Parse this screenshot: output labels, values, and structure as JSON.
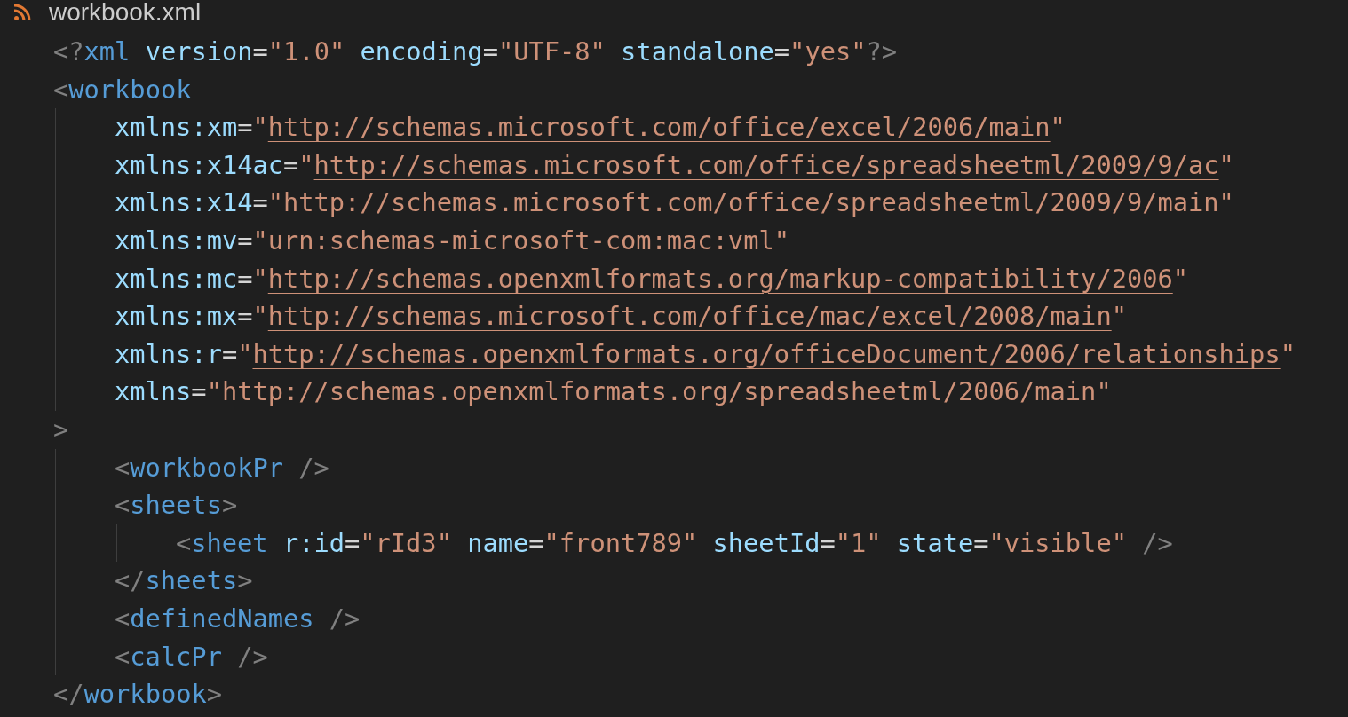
{
  "file_tab": {
    "title": "workbook.xml"
  },
  "lines": [
    {
      "tokens": [
        {
          "kind": "bracket",
          "text": "<?"
        },
        {
          "kind": "tag",
          "text": "xml"
        },
        {
          "kind": "attr",
          "text": " version"
        },
        {
          "kind": "eq",
          "text": "="
        },
        {
          "kind": "string",
          "text": "\"1.0\""
        },
        {
          "kind": "attr",
          "text": " encoding"
        },
        {
          "kind": "eq",
          "text": "="
        },
        {
          "kind": "string",
          "text": "\"UTF-8\""
        },
        {
          "kind": "attr",
          "text": " standalone"
        },
        {
          "kind": "eq",
          "text": "="
        },
        {
          "kind": "string",
          "text": "\"yes\""
        },
        {
          "kind": "bracket",
          "text": "?>"
        }
      ]
    },
    {
      "tokens": [
        {
          "kind": "bracket",
          "text": "<"
        },
        {
          "kind": "tag",
          "text": "workbook"
        }
      ],
      "children": [
        {
          "tokens": [
            {
              "kind": "attr",
              "text": "xmlns:xm"
            },
            {
              "kind": "eq",
              "text": "="
            },
            {
              "kind": "string",
              "text": "\""
            },
            {
              "kind": "link",
              "text": "http://schemas.microsoft.com/office/excel/2006/main"
            },
            {
              "kind": "string",
              "text": "\""
            }
          ]
        },
        {
          "tokens": [
            {
              "kind": "attr",
              "text": "xmlns:x14ac"
            },
            {
              "kind": "eq",
              "text": "="
            },
            {
              "kind": "string",
              "text": "\""
            },
            {
              "kind": "link",
              "text": "http://schemas.microsoft.com/office/spreadsheetml/2009/9/ac"
            },
            {
              "kind": "string",
              "text": "\""
            }
          ]
        },
        {
          "tokens": [
            {
              "kind": "attr",
              "text": "xmlns:x14"
            },
            {
              "kind": "eq",
              "text": "="
            },
            {
              "kind": "string",
              "text": "\""
            },
            {
              "kind": "link",
              "text": "http://schemas.microsoft.com/office/spreadsheetml/2009/9/main"
            },
            {
              "kind": "string",
              "text": "\""
            }
          ]
        },
        {
          "tokens": [
            {
              "kind": "attr",
              "text": "xmlns:mv"
            },
            {
              "kind": "eq",
              "text": "="
            },
            {
              "kind": "string",
              "text": "\"urn:schemas-microsoft-com:mac:vml\""
            }
          ]
        },
        {
          "tokens": [
            {
              "kind": "attr",
              "text": "xmlns:mc"
            },
            {
              "kind": "eq",
              "text": "="
            },
            {
              "kind": "string",
              "text": "\""
            },
            {
              "kind": "link",
              "text": "http://schemas.openxmlformats.org/markup-compatibility/2006"
            },
            {
              "kind": "string",
              "text": "\""
            }
          ]
        },
        {
          "tokens": [
            {
              "kind": "attr",
              "text": "xmlns:mx"
            },
            {
              "kind": "eq",
              "text": "="
            },
            {
              "kind": "string",
              "text": "\""
            },
            {
              "kind": "link",
              "text": "http://schemas.microsoft.com/office/mac/excel/2008/main"
            },
            {
              "kind": "string",
              "text": "\""
            }
          ]
        },
        {
          "tokens": [
            {
              "kind": "attr",
              "text": "xmlns:r"
            },
            {
              "kind": "eq",
              "text": "="
            },
            {
              "kind": "string",
              "text": "\""
            },
            {
              "kind": "link",
              "text": "http://schemas.openxmlformats.org/officeDocument/2006/relationships"
            },
            {
              "kind": "string",
              "text": "\""
            }
          ]
        },
        {
          "tokens": [
            {
              "kind": "attr",
              "text": "xmlns"
            },
            {
              "kind": "eq",
              "text": "="
            },
            {
              "kind": "string",
              "text": "\""
            },
            {
              "kind": "link",
              "text": "http://schemas.openxmlformats.org/spreadsheetml/2006/main"
            },
            {
              "kind": "string",
              "text": "\""
            }
          ]
        }
      ]
    },
    {
      "tokens": [
        {
          "kind": "bracket",
          "text": ">"
        }
      ],
      "children": [
        {
          "tokens": [
            {
              "kind": "bracket",
              "text": "<"
            },
            {
              "kind": "tag",
              "text": "workbookPr"
            },
            {
              "kind": "bracket",
              "text": " />"
            }
          ]
        },
        {
          "tokens": [
            {
              "kind": "bracket",
              "text": "<"
            },
            {
              "kind": "tag",
              "text": "sheets"
            },
            {
              "kind": "bracket",
              "text": ">"
            }
          ],
          "children": [
            {
              "tokens": [
                {
                  "kind": "bracket",
                  "text": "<"
                },
                {
                  "kind": "tag",
                  "text": "sheet"
                },
                {
                  "kind": "attr",
                  "text": " r:id"
                },
                {
                  "kind": "eq",
                  "text": "="
                },
                {
                  "kind": "string",
                  "text": "\"rId3\""
                },
                {
                  "kind": "attr",
                  "text": " name"
                },
                {
                  "kind": "eq",
                  "text": "="
                },
                {
                  "kind": "string",
                  "text": "\"front789\""
                },
                {
                  "kind": "attr",
                  "text": " sheetId"
                },
                {
                  "kind": "eq",
                  "text": "="
                },
                {
                  "kind": "string",
                  "text": "\"1\""
                },
                {
                  "kind": "attr",
                  "text": " state"
                },
                {
                  "kind": "eq",
                  "text": "="
                },
                {
                  "kind": "string",
                  "text": "\"visible\""
                },
                {
                  "kind": "bracket",
                  "text": " />"
                }
              ]
            }
          ]
        },
        {
          "tokens": [
            {
              "kind": "bracket",
              "text": "</"
            },
            {
              "kind": "tag",
              "text": "sheets"
            },
            {
              "kind": "bracket",
              "text": ">"
            }
          ]
        },
        {
          "tokens": [
            {
              "kind": "bracket",
              "text": "<"
            },
            {
              "kind": "tag",
              "text": "definedNames"
            },
            {
              "kind": "bracket",
              "text": " />"
            }
          ]
        },
        {
          "tokens": [
            {
              "kind": "bracket",
              "text": "<"
            },
            {
              "kind": "tag",
              "text": "calcPr"
            },
            {
              "kind": "bracket",
              "text": " />"
            }
          ]
        }
      ]
    },
    {
      "tokens": [
        {
          "kind": "bracket",
          "text": "</"
        },
        {
          "kind": "tag",
          "text": "workbook"
        },
        {
          "kind": "bracket",
          "text": ">"
        }
      ]
    }
  ]
}
